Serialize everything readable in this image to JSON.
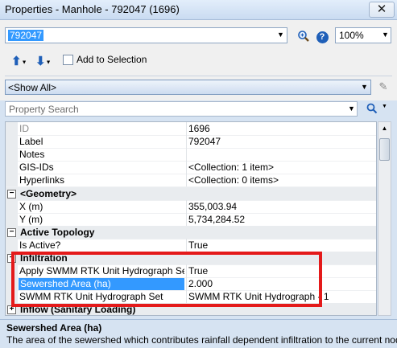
{
  "window": {
    "title": "Properties - Manhole - 792047 (1696)",
    "close_glyph": "✕"
  },
  "toolbar": {
    "element_id": "792047",
    "zoom": "100%",
    "add_to_selection_label": "Add to Selection",
    "add_to_selection_checked": false,
    "help_glyph": "?"
  },
  "filter": {
    "selected": "<Show All>"
  },
  "search": {
    "placeholder": "Property Search"
  },
  "grid": {
    "rows": [
      {
        "type": "prop",
        "name": "ID",
        "value": "1696",
        "readonly": true
      },
      {
        "type": "prop",
        "name": "Label",
        "value": "792047"
      },
      {
        "type": "prop",
        "name": "Notes",
        "value": ""
      },
      {
        "type": "prop",
        "name": "GIS-IDs",
        "value": "<Collection: 1 item>"
      },
      {
        "type": "prop",
        "name": "Hyperlinks",
        "value": "<Collection: 0 items>"
      },
      {
        "type": "category",
        "name": "<Geometry>",
        "expander": "−"
      },
      {
        "type": "prop",
        "name": "X (m)",
        "value": "355,003.94"
      },
      {
        "type": "prop",
        "name": "Y (m)",
        "value": "5,734,284.52"
      },
      {
        "type": "category",
        "name": "Active Topology",
        "expander": "−"
      },
      {
        "type": "prop",
        "name": "Is Active?",
        "value": "True"
      },
      {
        "type": "category",
        "name": "Infiltration",
        "expander": "−"
      },
      {
        "type": "prop",
        "name": "Apply SWMM RTK Unit Hydrograph Set?",
        "value": "True"
      },
      {
        "type": "prop",
        "name": "Sewershed Area (ha)",
        "value": "2.000",
        "selected": true
      },
      {
        "type": "prop",
        "name": "SWMM RTK Unit Hydrograph Set",
        "value": "SWMM RTK Unit Hydrograph - 1"
      },
      {
        "type": "category",
        "name": "Inflow (Sanitary Loading)",
        "expander": "+"
      }
    ]
  },
  "description": {
    "title": "Sewershed Area (ha)",
    "text": "The area of the sewershed which contributes rainfall dependent infiltration to the current node."
  },
  "colors": {
    "selection": "#3399ff",
    "annotation": "#e41a1a",
    "accent": "#1f5fb8"
  }
}
